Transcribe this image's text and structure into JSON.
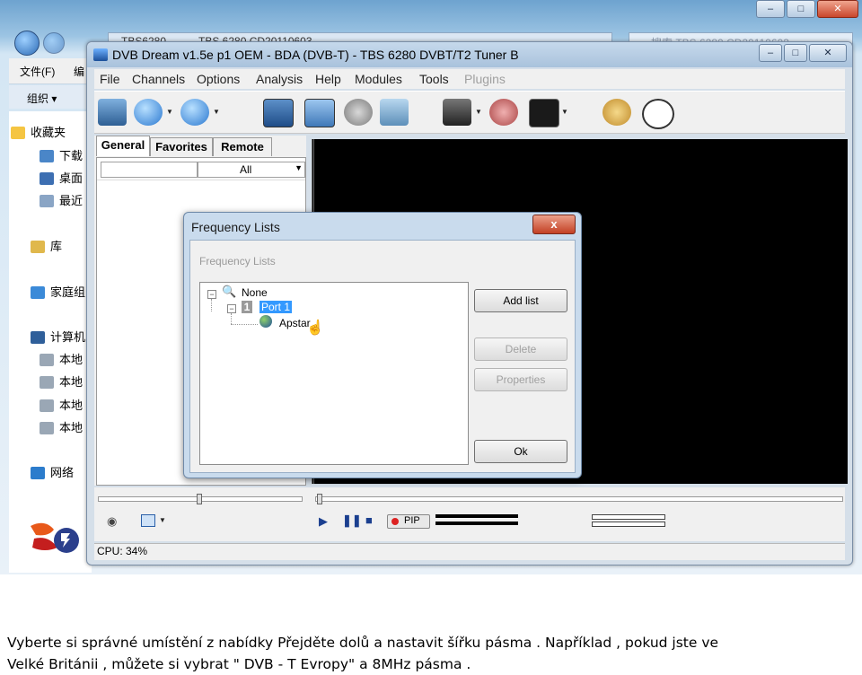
{
  "explorer": {
    "breadcrumb": [
      "TBS6280",
      "TBS 6280 CD20110603"
    ],
    "search_placeholder": "搜索 TBS 6280 CD20110603",
    "menu": [
      "文件(F)",
      "编"
    ],
    "organize_label": "组织 ▾",
    "sidebar": [
      {
        "label": "收藏夹",
        "icon": "star-icon"
      },
      {
        "label": "下载",
        "icon": "download-folder-icon"
      },
      {
        "label": "桌面",
        "icon": "desktop-icon"
      },
      {
        "label": "最近",
        "icon": "recent-places-icon"
      },
      {
        "label": "库",
        "icon": "library-icon"
      },
      {
        "label": "家庭组",
        "icon": "homegroup-icon"
      },
      {
        "label": "计算机",
        "icon": "computer-icon"
      },
      {
        "label": "本地",
        "icon": "drive-icon"
      },
      {
        "label": "本地",
        "icon": "drive-icon"
      },
      {
        "label": "本地",
        "icon": "drive-icon"
      },
      {
        "label": "本地",
        "icon": "drive-icon"
      },
      {
        "label": "网络",
        "icon": "network-icon"
      }
    ]
  },
  "app": {
    "title": "DVB Dream v1.5e p1 OEM - BDA (DVB-T)  -  TBS 6280 DVBT/T2 Tuner B",
    "menu": [
      "File",
      "Channels",
      "Options",
      "Analysis",
      "Help",
      "Modules",
      "Tools",
      "Plugins"
    ],
    "menu_disabled": "Plugins",
    "tabs": [
      "General",
      "Favorites",
      "Remote"
    ],
    "filter_value": "All",
    "status_cpu": "CPU: 34%",
    "pip_label": "PIP"
  },
  "dialog": {
    "title": "Frequency Lists",
    "close_label": "x",
    "group_label": "Frequency Lists",
    "tree": {
      "root": "None",
      "port_number": "1",
      "port": "Port 1",
      "child": "Apstar"
    },
    "buttons": {
      "add": "Add list",
      "delete": "Delete",
      "properties": "Properties",
      "ok": "Ok"
    }
  },
  "caption": {
    "line1": "Vyberte si správné umístění z nabídky Přejděte dolů a nastavit šířku pásma . Například , pokud jste ve",
    "line2": "Velké Británii , můžete si vybrat \" DVB - T Evropy\" a 8MHz pásma ."
  }
}
